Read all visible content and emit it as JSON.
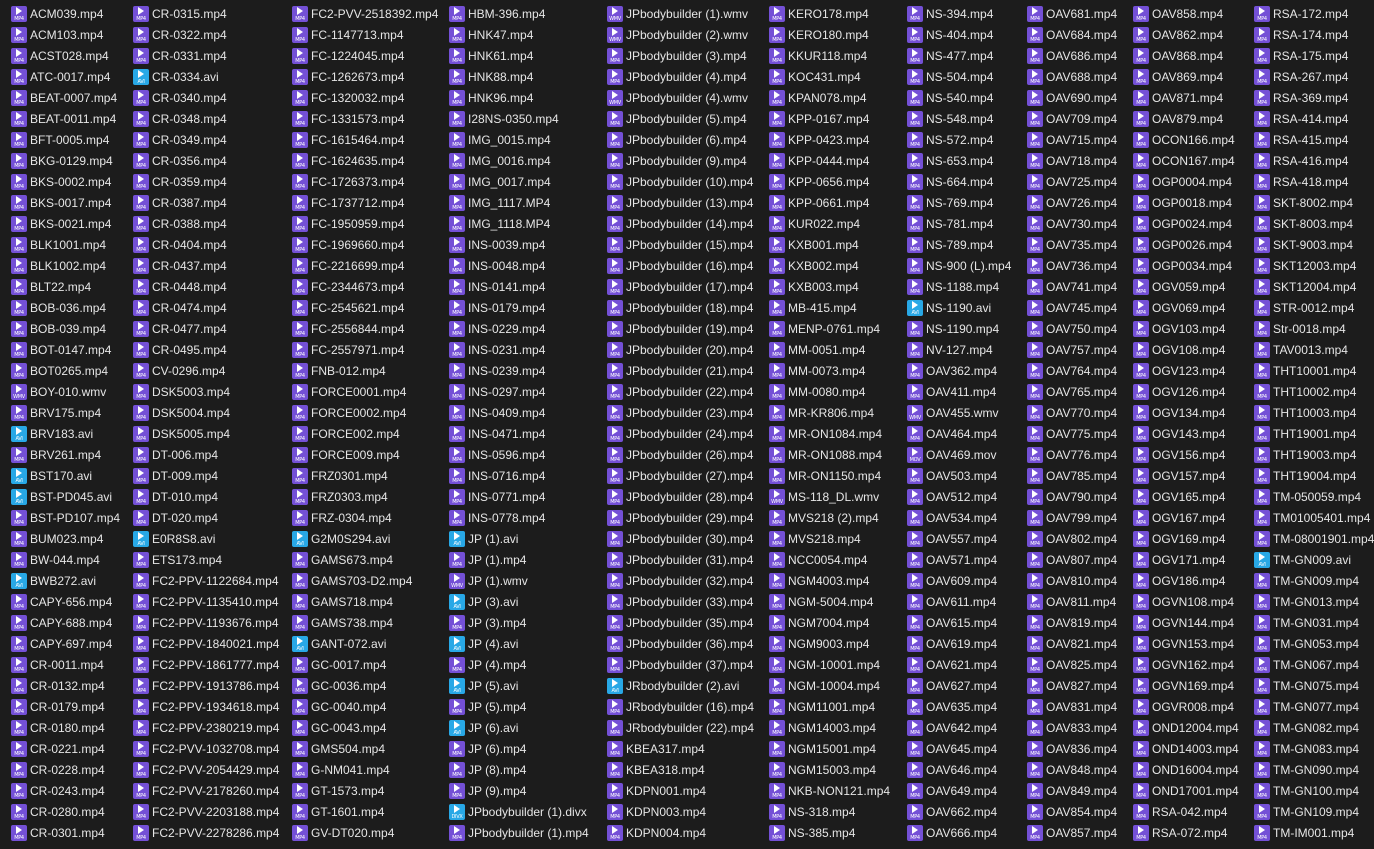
{
  "colors": {
    "background": "#1c1c1c",
    "text": "#e6e6e6",
    "mp4_icon": "#7450d6",
    "avi_icon": "#28a8e6"
  },
  "icon_names": {
    "mp4": "mp4-video-file-icon",
    "wmv": "wmv-video-file-icon",
    "mov": "mov-video-file-icon",
    "avi": "avi-video-file-icon",
    "divx": "divx-video-file-icon"
  },
  "icon_ext_labels": {
    "mp4": "MP4",
    "wmv": "WMV",
    "mov": "MOV",
    "avi": "AVI",
    "divx": "DIVX"
  },
  "columns": [
    [
      "ACM039.mp4",
      "ACM103.mp4",
      "ACST028.mp4",
      "ATC-0017.mp4",
      "BEAT-0007.mp4",
      "BEAT-0011.mp4",
      "BFT-0005.mp4",
      "BKG-0129.mp4",
      "BKS-0002.mp4",
      "BKS-0017.mp4",
      "BKS-0021.mp4",
      "BLK1001.mp4",
      "BLK1002.mp4",
      "BLT22.mp4",
      "BOB-036.mp4",
      "BOB-039.mp4",
      "BOT-0147.mp4",
      "BOT0265.mp4",
      "BOY-010.wmv",
      "BRV175.mp4",
      "BRV183.avi",
      "BRV261.mp4",
      "BST170.avi",
      "BST-PD045.avi",
      "BST-PD107.mp4",
      "BUM023.mp4",
      "BW-044.mp4",
      "BWB272.avi",
      "CAPY-656.mp4",
      "CAPY-688.mp4",
      "CAPY-697.mp4",
      "CR-0011.mp4",
      "CR-0132.mp4",
      "CR-0179.mp4",
      "CR-0180.mp4",
      "CR-0221.mp4",
      "CR-0228.mp4",
      "CR-0243.mp4",
      "CR-0280.mp4",
      "CR-0301.mp4"
    ],
    [
      "CR-0315.mp4",
      "CR-0322.mp4",
      "CR-0331.mp4",
      "CR-0334.avi",
      "CR-0340.mp4",
      "CR-0348.mp4",
      "CR-0349.mp4",
      "CR-0356.mp4",
      "CR-0359.mp4",
      "CR-0387.mp4",
      "CR-0388.mp4",
      "CR-0404.mp4",
      "CR-0437.mp4",
      "CR-0448.mp4",
      "CR-0474.mp4",
      "CR-0477.mp4",
      "CR-0495.mp4",
      "CV-0296.mp4",
      "DSK5003.mp4",
      "DSK5004.mp4",
      "DSK5005.mp4",
      "DT-006.mp4",
      "DT-009.mp4",
      "DT-010.mp4",
      "DT-020.mp4",
      "E0R8S8.avi",
      "ETS173.mp4",
      "FC2-PPV-1122684.mp4",
      "FC2-PPV-1135410.mp4",
      "FC2-PPV-1193676.mp4",
      "FC2-PPV-1840021.mp4",
      "FC2-PPV-1861777.mp4",
      "FC2-PPV-1913786.mp4",
      "FC2-PPV-1934618.mp4",
      "FC2-PPV-2380219.mp4",
      "FC2-PVV-1032708.mp4",
      "FC2-PVV-2054429.mp4",
      "FC2-PVV-2178260.mp4",
      "FC2-PVV-2203188.mp4",
      "FC2-PVV-2278286.mp4"
    ],
    [
      "FC2-PVV-2518392.mp4",
      "FC-1147713.mp4",
      "FC-1224045.mp4",
      "FC-1262673.mp4",
      "FC-1320032.mp4",
      "FC-1331573.mp4",
      "FC-1615464.mp4",
      "FC-1624635.mp4",
      "FC-1726373.mp4",
      "FC-1737712.mp4",
      "FC-1950959.mp4",
      "FC-1969660.mp4",
      "FC-2216699.mp4",
      "FC-2344673.mp4",
      "FC-2545621.mp4",
      "FC-2556844.mp4",
      "FC-2557971.mp4",
      "FNB-012.mp4",
      "FORCE0001.mp4",
      "FORCE0002.mp4",
      "FORCE002.mp4",
      "FORCE009.mp4",
      "FRZ0301.mp4",
      "FRZ0303.mp4",
      "FRZ-0304.mp4",
      "G2M0S294.avi",
      "GAMS673.mp4",
      "GAMS703-D2.mp4",
      "GAMS718.mp4",
      "GAMS738.mp4",
      "GANT-072.avi",
      "GC-0017.mp4",
      "GC-0036.mp4",
      "GC-0040.mp4",
      "GC-0043.mp4",
      "GMS504.mp4",
      "G-NM041.mp4",
      "GT-1573.mp4",
      "GT-1601.mp4",
      "GV-DT020.mp4"
    ],
    [
      "HBM-396.mp4",
      "HNK47.mp4",
      "HNK61.mp4",
      "HNK88.mp4",
      "HNK96.mp4",
      "I28NS-0350.mp4",
      "IMG_0015.mp4",
      "IMG_0016.mp4",
      "IMG_0017.mp4",
      "IMG_1117.MP4",
      "IMG_1118.MP4",
      "INS-0039.mp4",
      "INS-0048.mp4",
      "INS-0141.mp4",
      "INS-0179.mp4",
      "INS-0229.mp4",
      "INS-0231.mp4",
      "INS-0239.mp4",
      "INS-0297.mp4",
      "INS-0409.mp4",
      "INS-0471.mp4",
      "INS-0596.mp4",
      "INS-0716.mp4",
      "INS-0771.mp4",
      "INS-0778.mp4",
      "JP (1).avi",
      "JP (1).mp4",
      "JP (1).wmv",
      "JP (3).avi",
      "JP (3).mp4",
      "JP (4).avi",
      "JP (4).mp4",
      "JP (5).avi",
      "JP (5).mp4",
      "JP (6).avi",
      "JP (6).mp4",
      "JP (8).mp4",
      "JP (9).mp4",
      "JPbodybuilder (1).divx",
      "JPbodybuilder (1).mp4"
    ],
    [
      "JPbodybuilder (1).wmv",
      "JPbodybuilder (2).wmv",
      "JPbodybuilder (3).mp4",
      "JPbodybuilder (4).mp4",
      "JPbodybuilder (4).wmv",
      "JPbodybuilder (5).mp4",
      "JPbodybuilder (6).mp4",
      "JPbodybuilder (9).mp4",
      "JPbodybuilder (10).mp4",
      "JPbodybuilder (13).mp4",
      "JPbodybuilder (14).mp4",
      "JPbodybuilder (15).mp4",
      "JPbodybuilder (16).mp4",
      "JPbodybuilder (17).mp4",
      "JPbodybuilder (18).mp4",
      "JPbodybuilder (19).mp4",
      "JPbodybuilder (20).mp4",
      "JPbodybuilder (21).mp4",
      "JPbodybuilder (22).mp4",
      "JPbodybuilder (23).mp4",
      "JPbodybuilder (24).mp4",
      "JPbodybuilder (26).mp4",
      "JPbodybuilder (27).mp4",
      "JPbodybuilder (28).mp4",
      "JPbodybuilder (29).mp4",
      "JPbodybuilder (30).mp4",
      "JPbodybuilder (31).mp4",
      "JPbodybuilder (32).mp4",
      "JPbodybuilder (33).mp4",
      "JPbodybuilder (35).mp4",
      "JPbodybuilder (36).mp4",
      "JPbodybuilder (37).mp4",
      "JRbodybuilder (2).avi",
      "JRbodybuilder (16).mp4",
      "JRbodybuilder (22).mp4",
      "KBEA317.mp4",
      "KBEA318.mp4",
      "KDPN001.mp4",
      "KDPN003.mp4",
      "KDPN004.mp4"
    ],
    [
      "KERO178.mp4",
      "KERO180.mp4",
      "KKUR118.mp4",
      "KOC431.mp4",
      "KPAN078.mp4",
      "KPP-0167.mp4",
      "KPP-0423.mp4",
      "KPP-0444.mp4",
      "KPP-0656.mp4",
      "KPP-0661.mp4",
      "KUR022.mp4",
      "KXB001.mp4",
      "KXB002.mp4",
      "KXB003.mp4",
      "MB-415.mp4",
      "MENP-0761.mp4",
      "MM-0051.mp4",
      "MM-0073.mp4",
      "MM-0080.mp4",
      "MR-KR806.mp4",
      "MR-ON1084.mp4",
      "MR-ON1088.mp4",
      "MR-ON1150.mp4",
      "MS-118_DL.wmv",
      "MVS218 (2).mp4",
      "MVS218.mp4",
      "NCC0054.mp4",
      "NGM4003.mp4",
      "NGM-5004.mp4",
      "NGM7004.mp4",
      "NGM9003.mp4",
      "NGM-10001.mp4",
      "NGM-10004.mp4",
      "NGM11001.mp4",
      "NGM14003.mp4",
      "NGM15001.mp4",
      "NGM15003.mp4",
      "NKB-NON121.mp4",
      "NS-318.mp4",
      "NS-385.mp4"
    ],
    [
      "NS-394.mp4",
      "NS-404.mp4",
      "NS-477.mp4",
      "NS-504.mp4",
      "NS-540.mp4",
      "NS-548.mp4",
      "NS-572.mp4",
      "NS-653.mp4",
      "NS-664.mp4",
      "NS-769.mp4",
      "NS-781.mp4",
      "NS-789.mp4",
      "NS-900 (L).mp4",
      "NS-1188.mp4",
      "NS-1190.avi",
      "NS-1190.mp4",
      "NV-127.mp4",
      "OAV362.mp4",
      "OAV411.mp4",
      "OAV455.wmv",
      "OAV464.mp4",
      "OAV469.mov",
      "OAV503.mp4",
      "OAV512.mp4",
      "OAV534.mp4",
      "OAV557.mp4",
      "OAV571.mp4",
      "OAV609.mp4",
      "OAV611.mp4",
      "OAV615.mp4",
      "OAV619.mp4",
      "OAV621.mp4",
      "OAV627.mp4",
      "OAV635.mp4",
      "OAV642.mp4",
      "OAV645.mp4",
      "OAV646.mp4",
      "OAV649.mp4",
      "OAV662.mp4",
      "OAV666.mp4"
    ],
    [
      "OAV681.mp4",
      "OAV684.mp4",
      "OAV686.mp4",
      "OAV688.mp4",
      "OAV690.mp4",
      "OAV709.mp4",
      "OAV715.mp4",
      "OAV718.mp4",
      "OAV725.mp4",
      "OAV726.mp4",
      "OAV730.mp4",
      "OAV735.mp4",
      "OAV736.mp4",
      "OAV741.mp4",
      "OAV745.mp4",
      "OAV750.mp4",
      "OAV757.mp4",
      "OAV764.mp4",
      "OAV765.mp4",
      "OAV770.mp4",
      "OAV775.mp4",
      "OAV776.mp4",
      "OAV785.mp4",
      "OAV790.mp4",
      "OAV799.mp4",
      "OAV802.mp4",
      "OAV807.mp4",
      "OAV810.mp4",
      "OAV811.mp4",
      "OAV819.mp4",
      "OAV821.mp4",
      "OAV825.mp4",
      "OAV827.mp4",
      "OAV831.mp4",
      "OAV833.mp4",
      "OAV836.mp4",
      "OAV848.mp4",
      "OAV849.mp4",
      "OAV854.mp4",
      "OAV857.mp4"
    ],
    [
      "OAV858.mp4",
      "OAV862.mp4",
      "OAV868.mp4",
      "OAV869.mp4",
      "OAV871.mp4",
      "OAV879.mp4",
      "OCON166.mp4",
      "OCON167.mp4",
      "OGP0004.mp4",
      "OGP0018.mp4",
      "OGP0024.mp4",
      "OGP0026.mp4",
      "OGP0034.mp4",
      "OGV059.mp4",
      "OGV069.mp4",
      "OGV103.mp4",
      "OGV108.mp4",
      "OGV123.mp4",
      "OGV126.mp4",
      "OGV134.mp4",
      "OGV143.mp4",
      "OGV156.mp4",
      "OGV157.mp4",
      "OGV165.mp4",
      "OGV167.mp4",
      "OGV169.mp4",
      "OGV171.mp4",
      "OGV186.mp4",
      "OGVN108.mp4",
      "OGVN144.mp4",
      "OGVN153.mp4",
      "OGVN162.mp4",
      "OGVN169.mp4",
      "OGVR008.mp4",
      "OND12004.mp4",
      "OND14003.mp4",
      "OND16004.mp4",
      "OND17001.mp4",
      "RSA-042.mp4",
      "RSA-072.mp4"
    ],
    [
      "RSA-172.mp4",
      "RSA-174.mp4",
      "RSA-175.mp4",
      "RSA-267.mp4",
      "RSA-369.mp4",
      "RSA-414.mp4",
      "RSA-415.mp4",
      "RSA-416.mp4",
      "RSA-418.mp4",
      "SKT-8002.mp4",
      "SKT-8003.mp4",
      "SKT-9003.mp4",
      "SKT12003.mp4",
      "SKT12004.mp4",
      "STR-0012.mp4",
      "Str-0018.mp4",
      "TAV0013.mp4",
      "THT10001.mp4",
      "THT10002.mp4",
      "THT10003.mp4",
      "THT19001.mp4",
      "THT19003.mp4",
      "THT19004.mp4",
      "TM-050059.mp4",
      "TM01005401.mp4",
      "TM-08001901.mp4",
      "TM-GN009.avi",
      "TM-GN009.mp4",
      "TM-GN013.mp4",
      "TM-GN031.mp4",
      "TM-GN053.mp4",
      "TM-GN067.mp4",
      "TM-GN075.mp4",
      "TM-GN077.mp4",
      "TM-GN082.mp4",
      "TM-GN083.mp4",
      "TM-GN090.mp4",
      "TM-GN100.mp4",
      "TM-GN109.mp4",
      "TM-IM001.mp4"
    ]
  ]
}
